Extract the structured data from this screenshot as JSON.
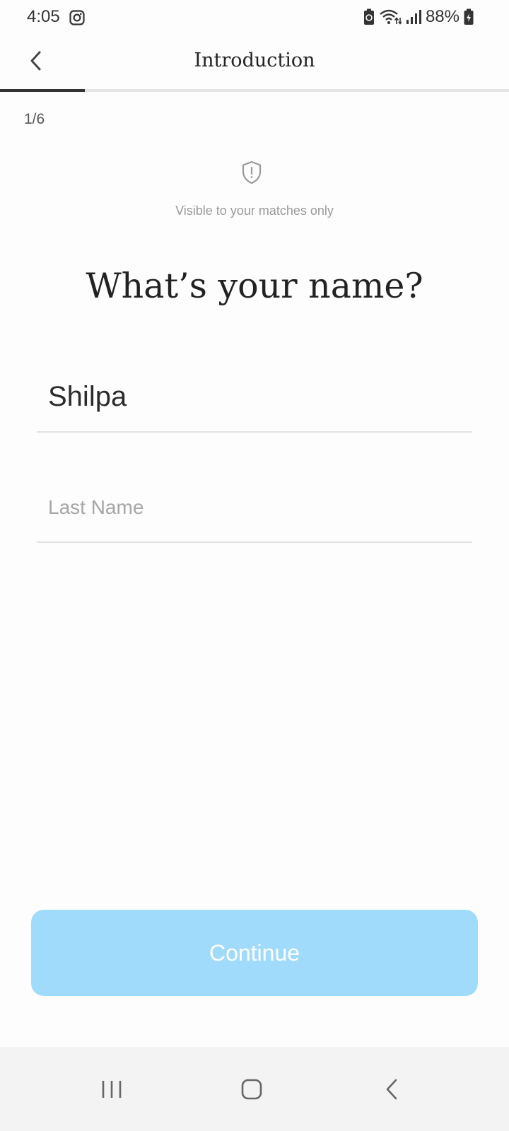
{
  "status_bar": {
    "time": "4:05",
    "battery_percent": "88%",
    "icons": [
      "instagram-icon",
      "battery-saver-icon",
      "wifi-icon",
      "signal-icon",
      "battery-icon"
    ]
  },
  "header": {
    "title": "Introduction",
    "back_icon": "chevron-left-icon"
  },
  "progress": {
    "current_step": 1,
    "total_steps": 6,
    "fraction": 0.1667
  },
  "step_counter": "1/6",
  "visibility": {
    "icon": "shield-alert-icon",
    "note": "Visible to your matches only"
  },
  "question": "What’s your name?",
  "form": {
    "first_name_value": "Shilpa",
    "last_name_placeholder": "Last Name",
    "last_name_value": ""
  },
  "continue_label": "Continue",
  "colors": {
    "continue_bg": "#a0dbfc",
    "progress_fill": "#333333",
    "progress_track": "#e4e4e6"
  },
  "nav_bar": {
    "recents_icon": "recents-icon",
    "home_icon": "home-icon",
    "back_icon": "back-icon"
  }
}
